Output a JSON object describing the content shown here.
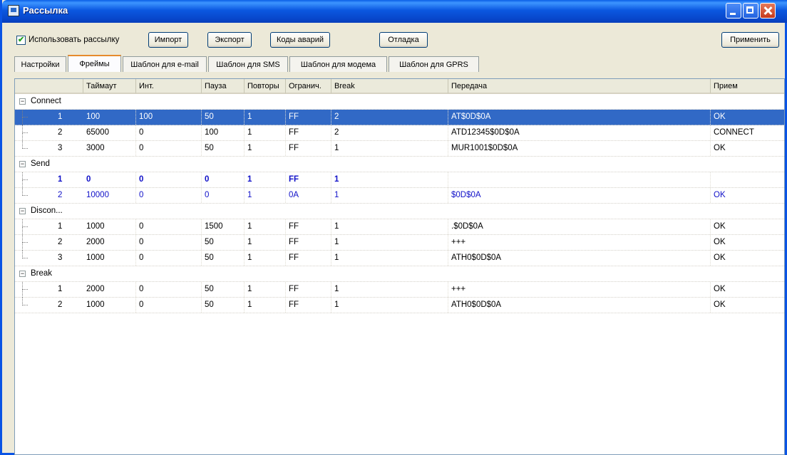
{
  "window": {
    "title": "Рассылка"
  },
  "toolbar": {
    "use_mailing_label": "Использовать рассылку",
    "use_mailing_checked": true,
    "import_label": "Импорт",
    "export_label": "Экспорт",
    "alarm_codes_label": "Коды аварий",
    "debug_label": "Отладка",
    "apply_label": "Применить"
  },
  "tabs": [
    {
      "label": "Настройки"
    },
    {
      "label": "Фреймы"
    },
    {
      "label": "Шаблон для e-mail"
    },
    {
      "label": "Шаблон для SMS"
    },
    {
      "label": "Шаблон для модема"
    },
    {
      "label": "Шаблон для GPRS"
    }
  ],
  "active_tab": "Фреймы",
  "columns": [
    "",
    "Таймаут",
    "Инт.",
    "Пауза",
    "Повторы",
    "Огранич.",
    "Break",
    "Передача",
    "Прием"
  ],
  "rows": [
    {
      "kind": "group",
      "name": "Connect",
      "expander": "⊟"
    },
    {
      "kind": "item",
      "id": "1",
      "timeout": "100",
      "int": "100",
      "pause": "50",
      "repeat": "1",
      "limit": "FF",
      "brk": "2",
      "send": "AT$0D$0A",
      "recv": "OK",
      "state": "selected"
    },
    {
      "kind": "item",
      "id": "2",
      "timeout": "65000",
      "int": "0",
      "pause": "100",
      "repeat": "1",
      "limit": "FF",
      "brk": "2",
      "send": "ATD12345$0D$0A",
      "recv": "CONNECT",
      "state": ""
    },
    {
      "kind": "item",
      "id": "3",
      "timeout": "3000",
      "int": "0",
      "pause": "50",
      "repeat": "1",
      "limit": "FF",
      "brk": "1",
      "send": "MUR1001$0D$0A",
      "recv": "OK",
      "state": ""
    },
    {
      "kind": "group",
      "name": "Send",
      "expander": "⊟"
    },
    {
      "kind": "item",
      "id": "1",
      "timeout": "0",
      "int": "0",
      "pause": "0",
      "repeat": "1",
      "limit": "FF",
      "brk": "1",
      "send": "",
      "recv": "",
      "state": "bold"
    },
    {
      "kind": "item",
      "id": "2",
      "timeout": "10000",
      "int": "0",
      "pause": "0",
      "repeat": "1",
      "limit": "0A",
      "brk": "1",
      "send": "$0D$0A",
      "recv": "OK",
      "state": "blue"
    },
    {
      "kind": "group",
      "name": "Discon...",
      "expander": "⊟"
    },
    {
      "kind": "item",
      "id": "1",
      "timeout": "1000",
      "int": "0",
      "pause": "1500",
      "repeat": "1",
      "limit": "FF",
      "brk": "1",
      "send": ".$0D$0A",
      "recv": "OK",
      "state": ""
    },
    {
      "kind": "item",
      "id": "2",
      "timeout": "2000",
      "int": "0",
      "pause": "50",
      "repeat": "1",
      "limit": "FF",
      "brk": "1",
      "send": "+++",
      "recv": "OK",
      "state": ""
    },
    {
      "kind": "item",
      "id": "3",
      "timeout": "1000",
      "int": "0",
      "pause": "50",
      "repeat": "1",
      "limit": "FF",
      "brk": "1",
      "send": "ATH0$0D$0A",
      "recv": "OK",
      "state": ""
    },
    {
      "kind": "group",
      "name": "Break",
      "expander": "⊟"
    },
    {
      "kind": "item",
      "id": "1",
      "timeout": "2000",
      "int": "0",
      "pause": "50",
      "repeat": "1",
      "limit": "FF",
      "brk": "1",
      "send": "+++",
      "recv": "OK",
      "state": ""
    },
    {
      "kind": "item",
      "id": "2",
      "timeout": "1000",
      "int": "0",
      "pause": "50",
      "repeat": "1",
      "limit": "FF",
      "brk": "1",
      "send": "ATH0$0D$0A",
      "recv": "OK",
      "state": ""
    }
  ],
  "colors": {
    "selection": "#3169c6",
    "highlight_text": "#1010c8",
    "titlebar": "#0a54e4"
  }
}
